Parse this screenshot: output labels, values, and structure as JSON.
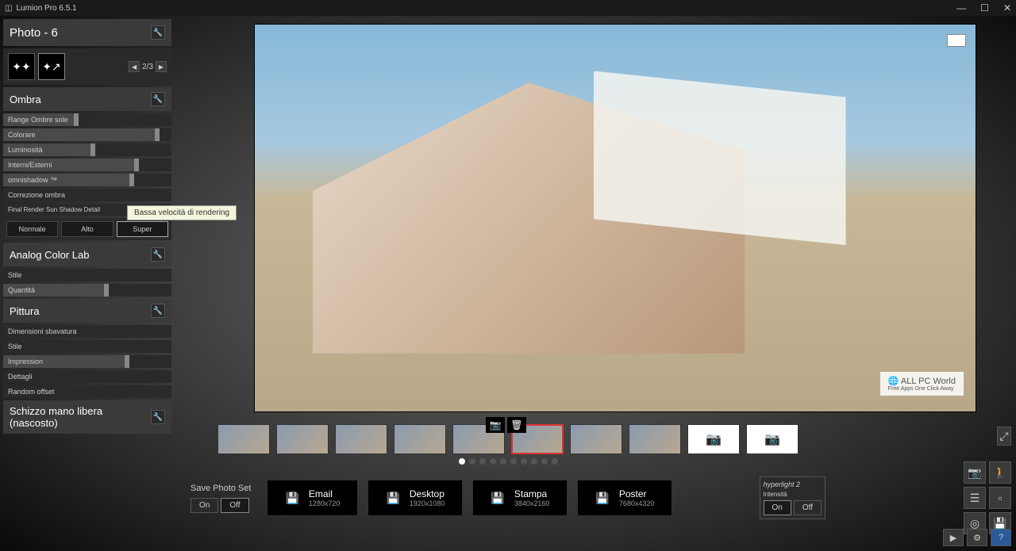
{
  "app": {
    "title": "Lumion Pro 6.5.1"
  },
  "sidebar": {
    "photo_header": "Photo - 6",
    "pager": "2/3",
    "ombra": {
      "title": "Ombra",
      "sliders": [
        {
          "label": "Range Ombre sole",
          "pos": 42
        },
        {
          "label": "Colorare",
          "pos": 90
        },
        {
          "label": "Luminosità",
          "pos": 52
        },
        {
          "label": "Interni/Esterni",
          "pos": 78
        },
        {
          "label": "omnishadow ™",
          "pos": 75
        },
        {
          "label": "Correzione ombra",
          "pos": 0
        }
      ],
      "detail_label": "Final Render Sun Shadow Detail",
      "options": [
        "Normale",
        "Alto",
        "Super"
      ]
    },
    "analog": {
      "title": "Analog Color Lab",
      "sliders": [
        {
          "label": "Stile",
          "pos": 0
        },
        {
          "label": "Quantità",
          "pos": 60
        }
      ]
    },
    "pittura": {
      "title": "Pittura",
      "sliders": [
        {
          "label": "Dimensioni sbavatura",
          "pos": 0
        },
        {
          "label": "Stile",
          "pos": 0
        },
        {
          "label": "Impression",
          "pos": 72
        },
        {
          "label": "Dettagli",
          "pos": 0
        },
        {
          "label": "Random offset",
          "pos": 0
        }
      ]
    },
    "schizzo": {
      "title": "Schizzo mano libera (nascosto)"
    }
  },
  "tooltip": "Bassa velocità di rendering",
  "watermark": {
    "text": "ALL PC World",
    "sub": "Free Apps One Click Away"
  },
  "bottom": {
    "save_label": "Save Photo Set",
    "on": "On",
    "off": "Off",
    "exports": [
      {
        "title": "Email",
        "res": "1280x720"
      },
      {
        "title": "Desktop",
        "res": "1920x1080"
      },
      {
        "title": "Stampa",
        "res": "3840x2160"
      },
      {
        "title": "Poster",
        "res": "7680x4320"
      }
    ],
    "hyperlight": {
      "title": "hyperlight 2",
      "intensity": "Intensità"
    }
  }
}
